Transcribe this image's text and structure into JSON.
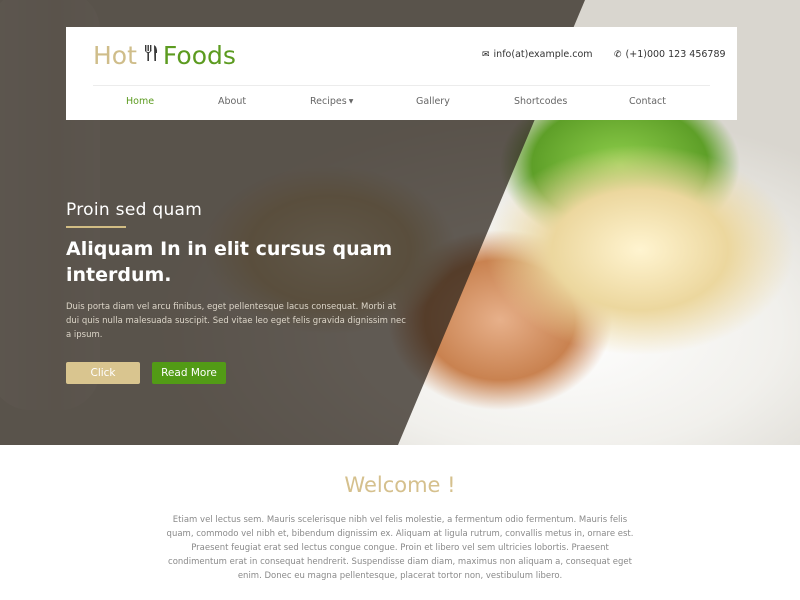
{
  "header": {
    "logo": {
      "part1": "Hot",
      "icon": "fork-knife-icon",
      "part2": "Foods"
    },
    "contact_email": "info(at)example.com",
    "contact_phone": "(+1)000 123 456789"
  },
  "nav": {
    "items": [
      {
        "label": "Home",
        "active": true
      },
      {
        "label": "About"
      },
      {
        "label": "Recipes",
        "dropdown": true
      },
      {
        "label": "Gallery"
      },
      {
        "label": "Shortcodes"
      },
      {
        "label": "Contact"
      }
    ]
  },
  "hero": {
    "subtitle": "Proin sed quam",
    "title": "Aliquam In in elit cursus quam interdum.",
    "text": "Duis porta diam vel arcu finibus, eget pellentesque lacus consequat. Morbi at dui quis nulla malesuada suscipit. Sed vitae leo eget felis gravida dignissim nec a ipsum.",
    "button_click": "Click",
    "button_more": "Read More"
  },
  "welcome": {
    "title": "Welcome !",
    "text": "Etiam vel lectus sem. Mauris scelerisque nibh vel felis molestie, a fermentum odio fermentum. Mauris felis quam, commodo vel nibh et, bibendum dignissim ex. Aliquam at ligula rutrum, convallis metus in, ornare est. Praesent feugiat erat sed lectus congue congue. Proin et libero vel sem ultricies lobortis. Praesent condimentum erat in consequat hendrerit. Suspendisse diam diam, maximus non aliquam a, consequat eget enim. Donec eu magna pellentesque, placerat tortor non, vestibulum libero."
  },
  "colors": {
    "accent_gold": "#d5c08d",
    "accent_green": "#529b16"
  }
}
